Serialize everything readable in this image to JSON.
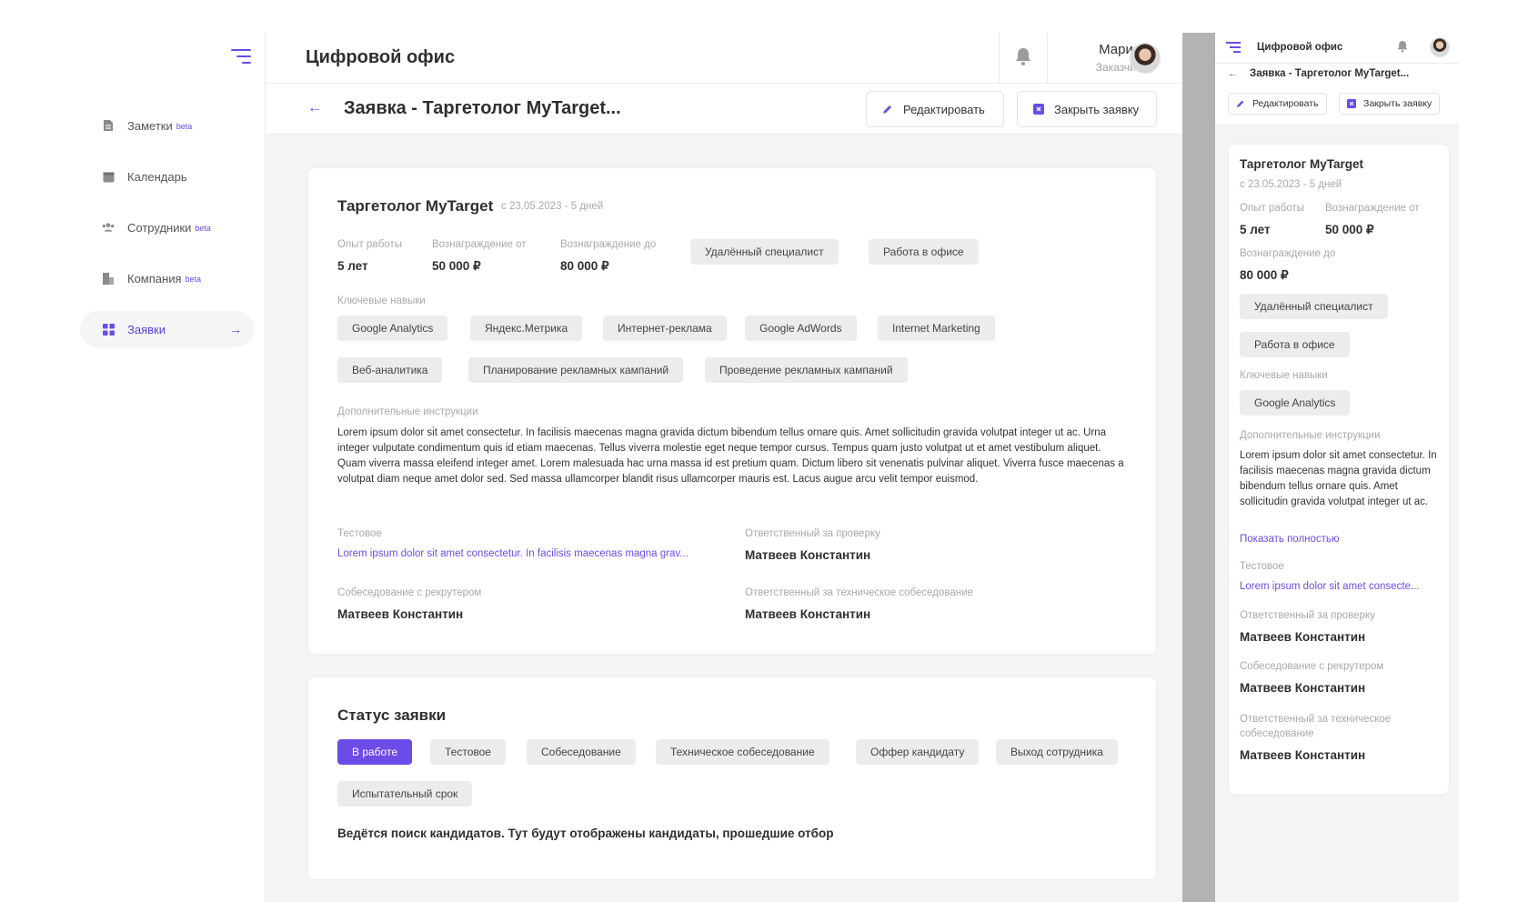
{
  "sidebar": {
    "items": [
      {
        "label": "Заметки",
        "badge": "beta",
        "icon": "notes-icon"
      },
      {
        "label": "Календарь",
        "badge": "",
        "icon": "calendar-icon"
      },
      {
        "label": "Сотрудники",
        "badge": "beta",
        "icon": "employees-icon"
      },
      {
        "label": "Компания",
        "badge": "beta",
        "icon": "company-icon"
      },
      {
        "label": "Заявки",
        "badge": "",
        "icon": "requests-grid-icon",
        "active": true
      }
    ]
  },
  "header": {
    "app_title": "Цифровой офис",
    "user_name": "Мария",
    "user_role": "Заказчик"
  },
  "request": {
    "title": "Заявка - Таргетолог MyTarget...",
    "edit_label": "Редактировать",
    "close_label": "Закрыть заявку"
  },
  "details": {
    "position": "Таргетолог MyTarget",
    "date_info": "с 23.05.2023 - 5 дней",
    "experience_label": "Опыт работы",
    "experience_value": "5 лет",
    "reward_from_label": "Вознаграждение от",
    "reward_from_value": "50 000 ₽",
    "reward_to_label": "Вознаграждение до",
    "reward_to_value": "80 000 ₽",
    "work_formats": [
      "Удалённый специалист",
      "Работа в офисе"
    ],
    "skills_label": "Ключевые навыки",
    "skills": [
      "Google Analytics",
      "Яндекс.Метрика",
      "Интернет-реклама",
      "Google AdWords",
      "Internet Marketing",
      "Веб-аналитика",
      "Планирование рекламных кампаний",
      "Проведение рекламных кампаний"
    ],
    "instructions_label": "Дополнительные инструкции",
    "instructions_text": "Lorem ipsum dolor sit amet consectetur. In facilisis maecenas magna gravida dictum bibendum tellus ornare quis. Amet sollicitudin gravida volutpat integer ut ac. Urna integer vulputate condimentum quis id etiam maecenas. Tellus viverra molestie eget neque tempor cursus. Tempus quam justo volutpat ut et amet vestibulum aliquet. Quam viverra massa eleifend integer amet. Lorem malesuada hac urna massa id est pretium quam. Dictum libero sit venenatis pulvinar aliquet. Viverra fusce maecenas a volutpat diam neque amet dolor sed. Sed massa ullamcorper blandit risus ullamcorper mauris est. Lacus augue arcu velit tempor euismod.",
    "test_label": "Тестовое",
    "test_link": "Lorem ipsum dolor sit amet consectetur. In facilisis maecenas magna grav...",
    "reviewer_label": "Ответственный за проверку",
    "reviewer_value": "Матвеев Константин",
    "recruiter_label": "Собеседование с рекрутером",
    "recruiter_value": "Матвеев Константин",
    "tech_label": "Ответственный за техническое собеседование",
    "tech_value": "Матвеев Константин"
  },
  "status": {
    "title": "Статус заявки",
    "stages": [
      "В работе",
      "Тестовое",
      "Собеседование",
      "Техническое собеседование",
      "Оффер кандидату",
      "Выход сотрудника",
      "Испытательный срок"
    ],
    "active_stage": "В работе",
    "message": "Ведётся поиск кандидатов. Тут будут отображены кандидаты, прошедшие отбор"
  },
  "mobile": {
    "app_title": "Цифровой офис",
    "request_title": "Заявка - Таргетолог MyTarget...",
    "edit_label": "Редактировать",
    "close_label": "Закрыть заявку",
    "position": "Таргетолог MyTarget",
    "date_info": "с 23.05.2023 - 5 дней",
    "experience_label": "Опыт работы",
    "experience_value": "5 лет",
    "reward_from_label": "Вознаграждение от",
    "reward_from_value": "50 000 ₽",
    "reward_to_label": "Вознаграждение до",
    "reward_to_value": "80 000 ₽",
    "work_formats": [
      "Удалённый специалист",
      "Работа в офисе"
    ],
    "skills_label": "Ключевые навыки",
    "skill": "Google Analytics",
    "instructions_label": "Дополнительные инструкции",
    "instructions_text": "Lorem ipsum dolor sit amet consectetur. In facilisis maecenas magna gravida dictum bibendum tellus ornare quis. Amet sollicitudin gravida volutpat integer ut ac.",
    "show_full": "Показать полностью",
    "test_label": "Тестовое",
    "test_link": "Lorem ipsum dolor sit amet consecte...",
    "reviewer_label": "Ответственный за проверку",
    "reviewer_value": "Матвеев Константин",
    "recruiter_label": "Собеседование с рекрутером",
    "recruiter_value": "Матвеев Константин",
    "tech_label": "Ответственный за техническое собеседование",
    "tech_value": "Матвеев Константин"
  },
  "colors": {
    "accent": "#6b4ce6",
    "chip": "#ececec",
    "background": "#f4f4f6",
    "divider": "#b3b3b3"
  }
}
